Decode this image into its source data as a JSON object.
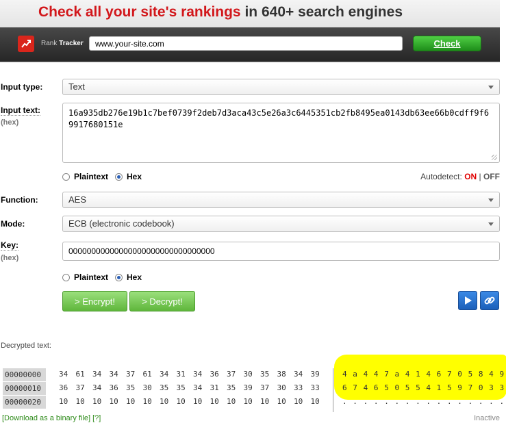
{
  "banner": {
    "headline_red": "Check all your site's rankings",
    "headline_rest": " in 640+ search engines",
    "brand_prefix": "Rank",
    "brand_bold": "Tracker",
    "site_input_value": "www.your-site.com",
    "check_label": "Check"
  },
  "form": {
    "input_type_label": "Input type:",
    "input_type_value": "Text",
    "input_text_label": "Input text:",
    "input_text_sub": "(hex)",
    "input_text_value": "16a935db276e19b1c7bef0739f2deb7d3aca43c5e26a3c6445351cb2fb8495ea0143db63ee66b0cdff9f69917680151e",
    "format_plaintext": "Plaintext",
    "format_hex": "Hex",
    "autodetect_label": "Autodetect:",
    "autodetect_on": "ON",
    "autodetect_sep": " | ",
    "autodetect_off": "OFF",
    "function_label": "Function:",
    "function_value": "AES",
    "mode_label": "Mode:",
    "mode_value": "ECB (electronic codebook)",
    "key_label": "Key:",
    "key_sub": "(hex)",
    "key_value": "00000000000000000000000000000000",
    "key_plaintext": "Plaintext",
    "key_hex": "Hex",
    "encrypt_label": "> Encrypt!",
    "decrypt_label": "> Decrypt!"
  },
  "output": {
    "decrypted_label": "Decrypted text:",
    "rows": [
      {
        "offset": "00000000",
        "bytes": [
          "34",
          "61",
          "34",
          "34",
          "37",
          "61",
          "34",
          "31",
          "34",
          "36",
          "37",
          "30",
          "35",
          "38",
          "34",
          "39"
        ],
        "ascii": [
          "4",
          "a",
          "4",
          "4",
          "7",
          "a",
          "4",
          "1",
          "4",
          "6",
          "7",
          "0",
          "5",
          "8",
          "4",
          "9"
        ]
      },
      {
        "offset": "00000010",
        "bytes": [
          "36",
          "37",
          "34",
          "36",
          "35",
          "30",
          "35",
          "35",
          "34",
          "31",
          "35",
          "39",
          "37",
          "30",
          "33",
          "33"
        ],
        "ascii": [
          "6",
          "7",
          "4",
          "6",
          "5",
          "0",
          "5",
          "5",
          "4",
          "1",
          "5",
          "9",
          "7",
          "0",
          "3",
          "3"
        ]
      },
      {
        "offset": "00000020",
        "bytes": [
          "10",
          "10",
          "10",
          "10",
          "10",
          "10",
          "10",
          "10",
          "10",
          "10",
          "10",
          "10",
          "10",
          "10",
          "10",
          "10"
        ],
        "ascii": [
          ".",
          ".",
          ".",
          ".",
          ".",
          ".",
          ".",
          ".",
          ".",
          ".",
          ".",
          ".",
          ".",
          ".",
          ".",
          "."
        ]
      }
    ],
    "download_link": "[Download as a binary file]",
    "help_link": "[?]",
    "status": "Inactive"
  },
  "colors": {
    "headline_red": "#d2171b",
    "check_green": "#2aa524",
    "button_green": "#7ccb5a",
    "button_blue": "#2b74d1",
    "highlight": "#ffff00",
    "autodetect_on": "#e00000"
  },
  "icons": [
    "rank-tracker-logo-icon",
    "chevron-down-icon",
    "play-icon",
    "link-icon"
  ]
}
